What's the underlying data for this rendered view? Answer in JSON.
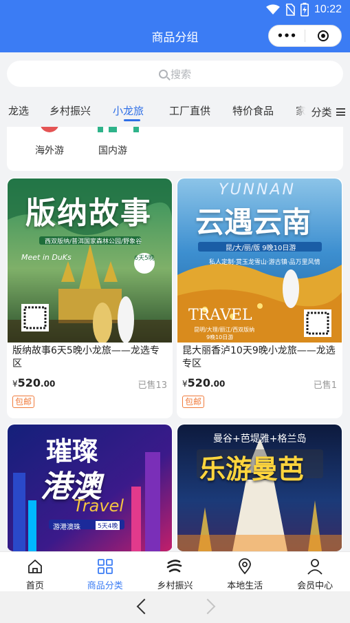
{
  "status_bar": {
    "time": "10:22"
  },
  "nav": {
    "title": "商品分组",
    "menu_glyph": "•••"
  },
  "search": {
    "placeholder": "搜索"
  },
  "tabs": [
    {
      "label": "龙选"
    },
    {
      "label": "乡村振兴"
    },
    {
      "label": "小龙旅",
      "active": true
    },
    {
      "label": "工厂直供"
    },
    {
      "label": "特价食品"
    },
    {
      "label": "家"
    }
  ],
  "category_button": {
    "label": "分类"
  },
  "subcategories": [
    {
      "label": "海外游",
      "icon": "overseas-icon"
    },
    {
      "label": "国内游",
      "icon": "domestic-icon"
    }
  ],
  "products": [
    {
      "title": "版纳故事6天5晚小龙旅——龙选专区",
      "price_int": "520",
      "price_dec": ".00",
      "currency": "¥",
      "sold": "已售13",
      "tag": "包邮",
      "poster": {
        "headline": "版纳故事",
        "sub": "西双版纳/普洱国家森林公园/野象谷",
        "badge": "6天5晚",
        "script": "Meet in DuKs"
      }
    },
    {
      "title": "昆大丽香泸10天9晚小龙旅——龙选专区",
      "price_int": "520",
      "price_dec": ".00",
      "currency": "¥",
      "sold": "已售1",
      "tag": "包邮",
      "poster": {
        "headline": "云遇云南",
        "script": "YUNNAN",
        "sub": "昆/大/丽/版 9晚10日游",
        "line2": "私人定制·赏玉龙雪山·游古镇·品万里风情",
        "travel": "TRAVEL",
        "route": "昆明/大理/丽江/西双版纳",
        "days": "9晚10日游"
      }
    },
    {
      "poster": {
        "headline1": "璀璨",
        "headline2": "港澳",
        "script": "Travel",
        "sub": "游港澳珠",
        "badge": "5天4晚"
      }
    },
    {
      "poster": {
        "top": "曼谷+芭堤雅+格兰岛",
        "headline": "乐游曼芭"
      }
    }
  ],
  "tabbar": [
    {
      "label": "首页",
      "icon": "home-icon"
    },
    {
      "label": "商品分类",
      "icon": "category-grid-icon",
      "active": true
    },
    {
      "label": "乡村振兴",
      "icon": "rural-logo-icon"
    },
    {
      "label": "本地生活",
      "icon": "location-pin-icon"
    },
    {
      "label": "会员中心",
      "icon": "user-icon"
    }
  ],
  "colors": {
    "brand": "#3b7cf4",
    "active_tab": "#2f6fe6",
    "tag": "#f07a3a"
  }
}
